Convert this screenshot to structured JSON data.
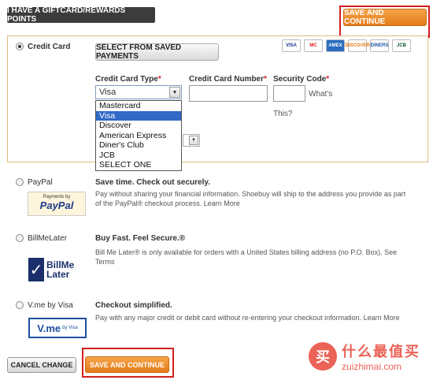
{
  "header": {
    "giftcard_label": "I HAVE A GIFTCARD/REWARDS POINTS",
    "save_label": "SAVE AND CONTINUE"
  },
  "credit_card": {
    "label": "Credit Card",
    "saved_payments_label": "SELECT FROM SAVED PAYMENTS",
    "card_logos": [
      "VISA",
      "MC",
      "AMEX",
      "DISCOVER",
      "DINERS",
      "JCB"
    ],
    "type_label": "Credit Card Type",
    "number_label": "Credit Card Number",
    "security_label": "Security Code",
    "required_mark": "*",
    "type_value": "Visa",
    "type_options": [
      "Mastercard",
      "Visa",
      "Discover",
      "American Express",
      "Diner's Club",
      "JCB",
      "SELECT ONE"
    ],
    "selected_option_index": 1,
    "whats_label": "What's",
    "this_label": "This?"
  },
  "paypal": {
    "label": "PayPal",
    "title": "Save time. Check out securely.",
    "desc": "Pay without sharing your financial information. Shoebuy will ship to the address you provide as part of the PayPal® checkout process. Learn More",
    "logo_top": "Payments by",
    "logo_text": "PayPal"
  },
  "billmelater": {
    "label": "BillMeLater",
    "title": "Buy Fast. Feel Secure.®",
    "desc": "Bill Me Later® is only available for orders with a United States billing address (no P.O. Box). See Terms",
    "logo_line1": "BillMe",
    "logo_line2": "Later"
  },
  "vme": {
    "label": "V.me by Visa",
    "title": "Checkout simplified.",
    "desc": "Pay with any major credit or debit card without re-entering your checkout information. Learn More",
    "logo_text": "V.me",
    "logo_sub": "by Visa"
  },
  "footer": {
    "cancel_label": "CANCEL CHANGE",
    "save_label": "SAVE AND CONTINUE"
  },
  "watermark": {
    "cn": "什么最值买",
    "en": "zuizhimai.com",
    "badge": "买"
  }
}
